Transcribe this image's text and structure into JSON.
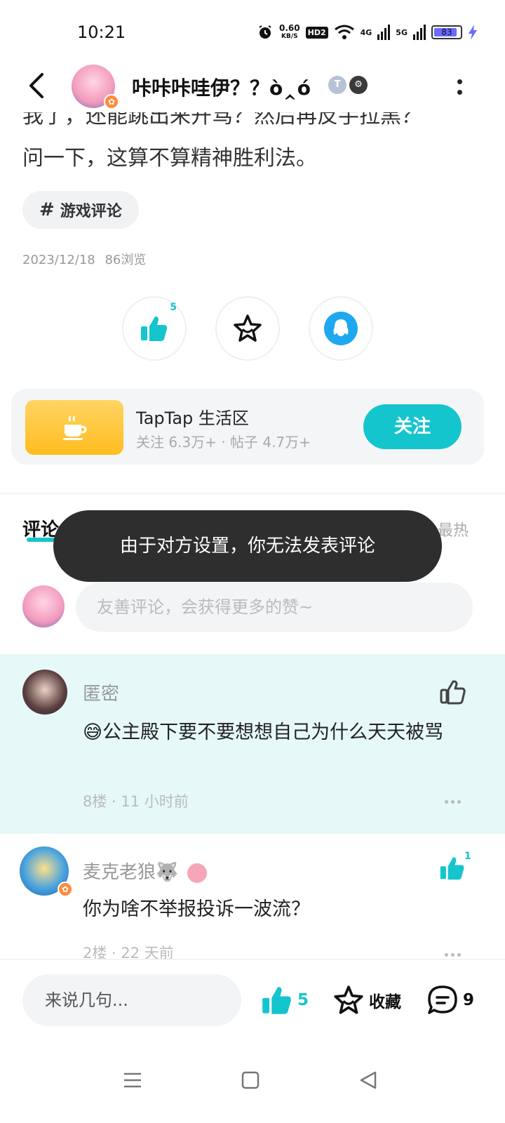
{
  "status_bar": {
    "time": "10:21",
    "net_speed_value": "0.60",
    "net_speed_unit": "KB/S",
    "hd_label": "HD2",
    "net_4g": "4G",
    "net_5g": "5G",
    "battery": "83"
  },
  "header": {
    "username": "咔咔咔哇伊？？ò‸ó",
    "badge_t": "T",
    "badge_gear": "⚙"
  },
  "post": {
    "line1": "我了，还能跳出来开骂？然后再反手拉黑？",
    "line2": "问一下，这算不算精神胜利法。",
    "tag": "游戏评论",
    "date": "2023/12/18",
    "views": "86浏览",
    "like_count": "5"
  },
  "community": {
    "name": "TapTap 生活区",
    "stats": "关注 6.3万+ · 帖子 4.7万+",
    "follow_label": "关注"
  },
  "comments": {
    "title": "评论",
    "sort": "最热",
    "toast": "由于对方设置，你无法发表评论",
    "input_placeholder": "友善评论，会获得更多的赞~",
    "items": [
      {
        "name": "匿密",
        "text": "😅公主殿下要不要想想自己为什么天天被骂",
        "meta": "8楼 · 11 小时前",
        "likes": ""
      },
      {
        "name": "麦克老狼🐺",
        "text": "你为啥不举报投诉一波流？",
        "meta": "2楼 · 22 天前",
        "likes": "1"
      }
    ]
  },
  "bottom_bar": {
    "input_placeholder": "来说几句...",
    "like_count": "5",
    "favorite_label": "收藏",
    "comment_count": "9"
  },
  "colors": {
    "accent": "#15c5ce",
    "toast_bg": "#2e2e2e",
    "highlight_bg": "#e6f8f8"
  }
}
